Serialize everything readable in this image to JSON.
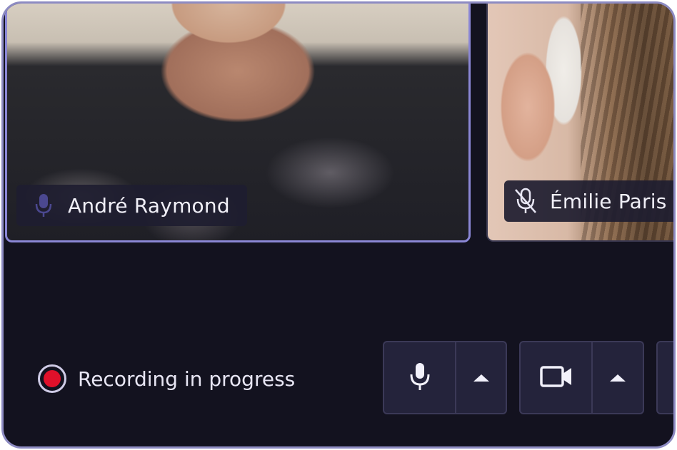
{
  "participants": [
    {
      "name": "André Raymond",
      "mic_state": "active",
      "mic_icon": "microphone-icon"
    },
    {
      "name": "Émilie Paris",
      "mic_state": "muted",
      "mic_icon": "microphone-muted-icon"
    }
  ],
  "recording": {
    "label": "Recording in progress",
    "indicator_color": "#e0102a"
  },
  "controls": {
    "microphone": {
      "icon": "microphone-icon",
      "menu_icon": "caret-up-icon"
    },
    "camera": {
      "icon": "video-camera-icon",
      "menu_icon": "caret-up-icon"
    }
  },
  "colors": {
    "background": "#13121f",
    "active_speaker_border": "#8b87d6",
    "button_bg": "#24233b",
    "button_border": "#3b3957",
    "text": "#f0eff7"
  }
}
